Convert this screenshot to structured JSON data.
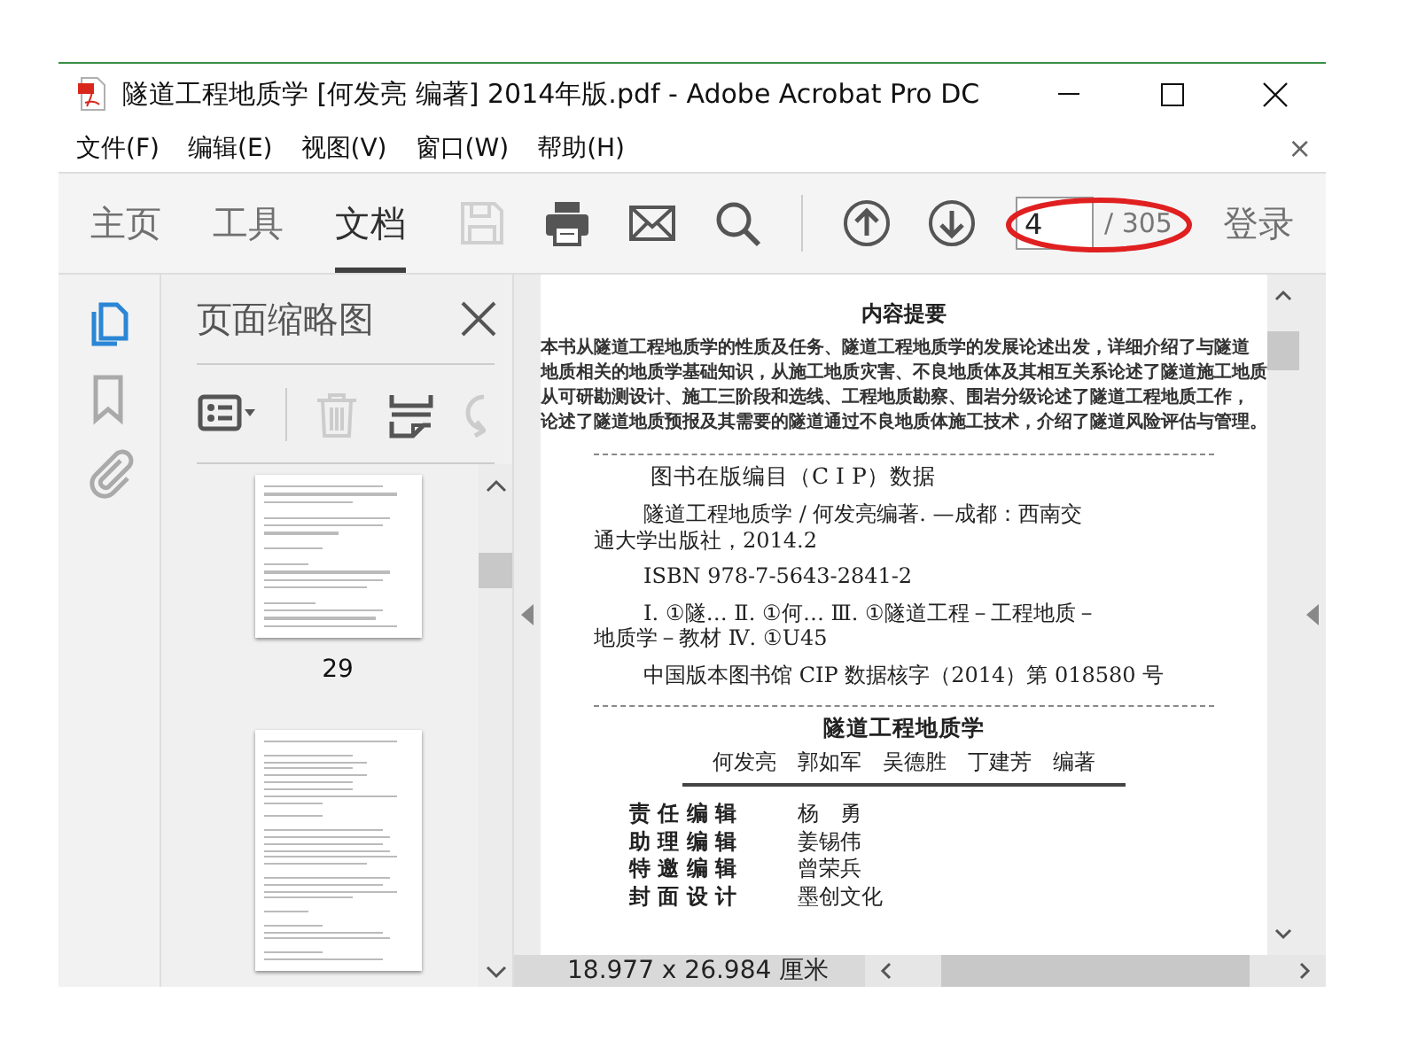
{
  "window": {
    "title": "隧道工程地质学 [何发亮 编著] 2014年版.pdf - Adobe Acrobat Pro DC"
  },
  "menu_bar": {
    "items": [
      "文件(F)",
      "编辑(E)",
      "视图(V)",
      "窗口(W)",
      "帮助(H)"
    ],
    "close": "×"
  },
  "toolbar": {
    "tabs": [
      {
        "label": "主页",
        "selected": false
      },
      {
        "label": "工具",
        "selected": false
      },
      {
        "label": "文档",
        "selected": true
      }
    ],
    "tools": [
      {
        "kind": "save",
        "disabled": true
      },
      {
        "kind": "print",
        "disabled": false
      },
      {
        "kind": "mail",
        "disabled": false
      },
      {
        "kind": "search",
        "disabled": false
      },
      {
        "kind": "prev",
        "disabled": false
      },
      {
        "kind": "next",
        "disabled": false
      }
    ],
    "page_field": {
      "value": "4"
    },
    "page_total": "/ 305",
    "sign_in": "登录",
    "annotation": {
      "kind": "ellipse",
      "color": "#e02020"
    }
  },
  "sidebar": {
    "rail": [
      {
        "kind": "pages",
        "selected": true
      },
      {
        "kind": "bookmarks",
        "selected": false
      },
      {
        "kind": "attachments",
        "selected": false
      }
    ],
    "panel": {
      "title": "页面缩略图",
      "tools": [
        {
          "kind": "options",
          "disabled": false
        },
        {
          "kind": "delete",
          "disabled": true
        },
        {
          "kind": "extract",
          "disabled": false
        },
        {
          "kind": "rotate",
          "disabled": true
        }
      ],
      "thumbnails": [
        {
          "kind": "short",
          "label": "29"
        },
        {
          "kind": "long"
        }
      ]
    }
  },
  "document": {
    "abstract_title": "内容提要",
    "abstract_lines": [
      "本书从隧道工程地质学的性质及任务、隧道工程地质学的发展论述出发，详细介绍了与隧道",
      "地质相关的地质学基础知识，从施工地质灾害、不良地质体及其相互关系论述了隧道施工地质",
      "从可研勘测设计、施工三阶段和选线、工程地质勘察、围岩分级论述了隧道工程地质工作，",
      "论述了隧道地质预报及其需要的隧道通过不良地质体施工技术，介绍了隧道风险评估与管理。"
    ],
    "cip_heading": "图书在版编目（C I P）数据",
    "cip_paragraphs": [
      [
        "隧道工程地质学 / 何发亮编著. —成都：西南交",
        "通大学出版社，2014.2"
      ],
      [
        "ISBN 978-7-5643-2841-2"
      ],
      [
        "Ⅰ. ①隧… Ⅱ. ①何… Ⅲ. ①隧道工程－工程地质－",
        "地质学－教材 Ⅳ. ①U45"
      ],
      [
        "中国版本图书馆 CIP 数据核字（2014）第 018580 号"
      ]
    ],
    "book_title": "隧道工程地质学",
    "authors": "何发亮　郭如军　吴德胜　丁建芳　编著",
    "credits": [
      {
        "role": "责 任 编 辑",
        "name": "杨　勇"
      },
      {
        "role": "助 理 编 辑",
        "name": "姜锡伟"
      },
      {
        "role": "特 邀 编 辑",
        "name": "曾荣兵"
      },
      {
        "role": "封 面 设 计",
        "name": "墨创文化"
      }
    ]
  },
  "status_bar": {
    "page_size": "18.977 x 26.984 厘米"
  }
}
